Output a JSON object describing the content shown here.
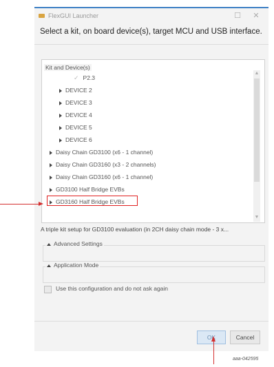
{
  "window": {
    "title": "FlexGUI Launcher",
    "maximize_glyph": "☐",
    "close_glyph": "✕"
  },
  "heading": "Select a kit, on board device(s), target MCU and USB interface.",
  "kit_section": {
    "legend": "Kit and Device(s)",
    "items": [
      {
        "label": "P2.3",
        "type": "checked-child"
      },
      {
        "label": "DEVICE 2",
        "type": "child"
      },
      {
        "label": "DEVICE 3",
        "type": "child"
      },
      {
        "label": "DEVICE 4",
        "type": "child"
      },
      {
        "label": "DEVICE 5",
        "type": "child"
      },
      {
        "label": "DEVICE 6",
        "type": "child"
      },
      {
        "label": "Daisy Chain GD3100 (x6 - 1 channel)",
        "type": "top"
      },
      {
        "label": "Daisy Chain GD3160 (x3 - 2 channels)",
        "type": "top"
      },
      {
        "label": "Daisy Chain GD3160 (x6 - 1 channel)",
        "type": "top"
      },
      {
        "label": "GD3100 Half Bridge EVBs",
        "type": "top"
      },
      {
        "label": "GD3160 Half Bridge EVBs",
        "type": "top",
        "highlighted": true
      }
    ]
  },
  "description": "A triple kit setup for GD3100 evaluation (in 2CH daisy chain mode - 3 x...",
  "advanced_settings": {
    "label": "Advanced Settings"
  },
  "application_mode": {
    "label": "Application Mode"
  },
  "remember_checkbox": {
    "label": "Use this configuration and do not ask again",
    "checked": false
  },
  "buttons": {
    "ok": "OK",
    "cancel": "Cancel"
  },
  "figure_id": "aaa-042595",
  "colors": {
    "highlight": "#e02020",
    "arrow": "#d43030",
    "ok_bg": "#dbe8f5"
  }
}
